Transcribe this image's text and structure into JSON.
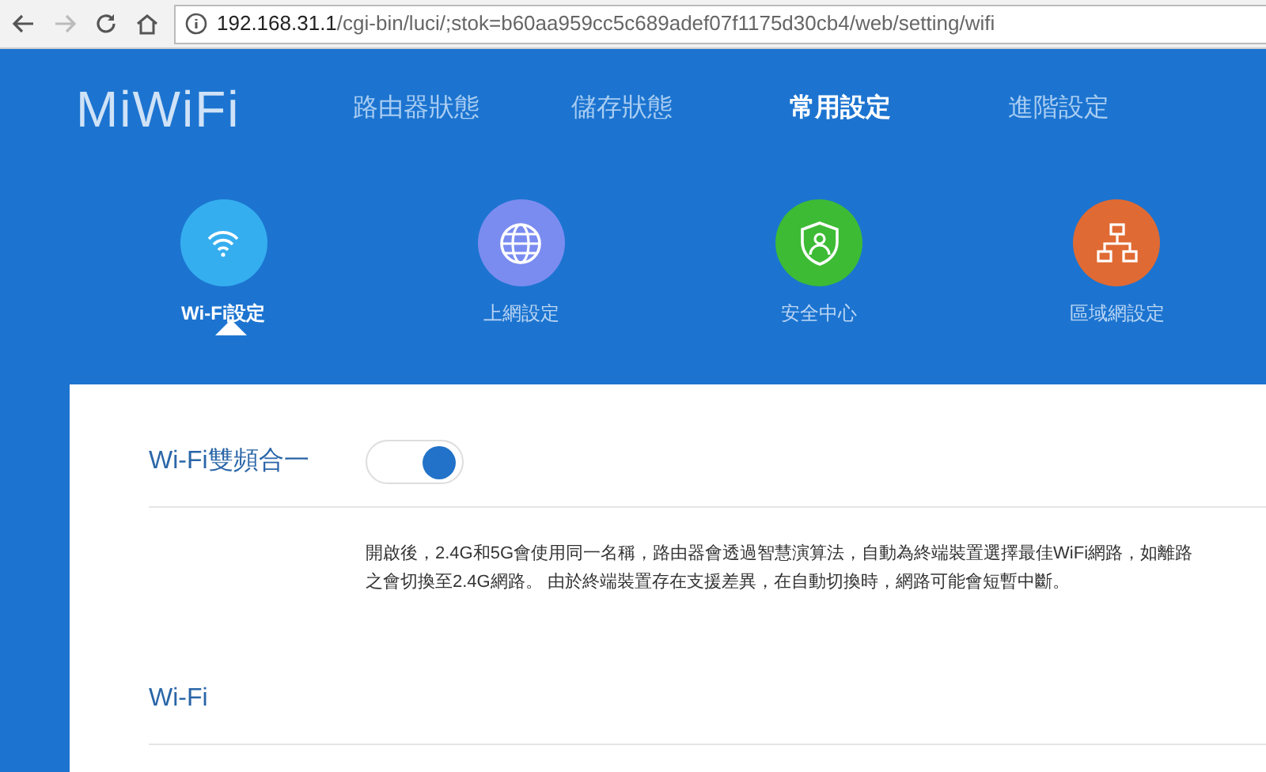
{
  "browser": {
    "url_host": "192.168.31.1",
    "url_path": "/cgi-bin/luci/;stok=b60aa959cc5c689adef07f1175d30cb4/web/setting/wifi",
    "forward_disabled": true
  },
  "logo": "MiWiFi",
  "nav": [
    {
      "label": "路由器狀態",
      "selected": false
    },
    {
      "label": "儲存狀態",
      "selected": false
    },
    {
      "label": "常用設定",
      "selected": true
    },
    {
      "label": "進階設定",
      "selected": false
    }
  ],
  "sections": [
    {
      "kind": "wifi",
      "label": "Wi-Fi設定",
      "selected": true,
      "color": "#35aef0"
    },
    {
      "kind": "globe",
      "label": "上網設定",
      "selected": false,
      "color": "#7b8cf0"
    },
    {
      "kind": "shield",
      "label": "安全中心",
      "selected": false,
      "color": "#3dbb35"
    },
    {
      "kind": "network",
      "label": "區域網設定",
      "selected": false,
      "color": "#e06a33"
    }
  ],
  "settings": [
    {
      "label": "Wi-Fi雙頻合一",
      "on": true,
      "description": [
        "開啟後，2.4G和5G會使用同一名稱，路由器會透過智慧演算法，自動為終端裝置選擇最佳WiFi網路，如離路",
        "之會切換至2.4G網路。 由於終端裝置存在支援差異，在自動切換時，網路可能會短暫中斷。"
      ]
    },
    {
      "label": "Wi-Fi"
    }
  ]
}
